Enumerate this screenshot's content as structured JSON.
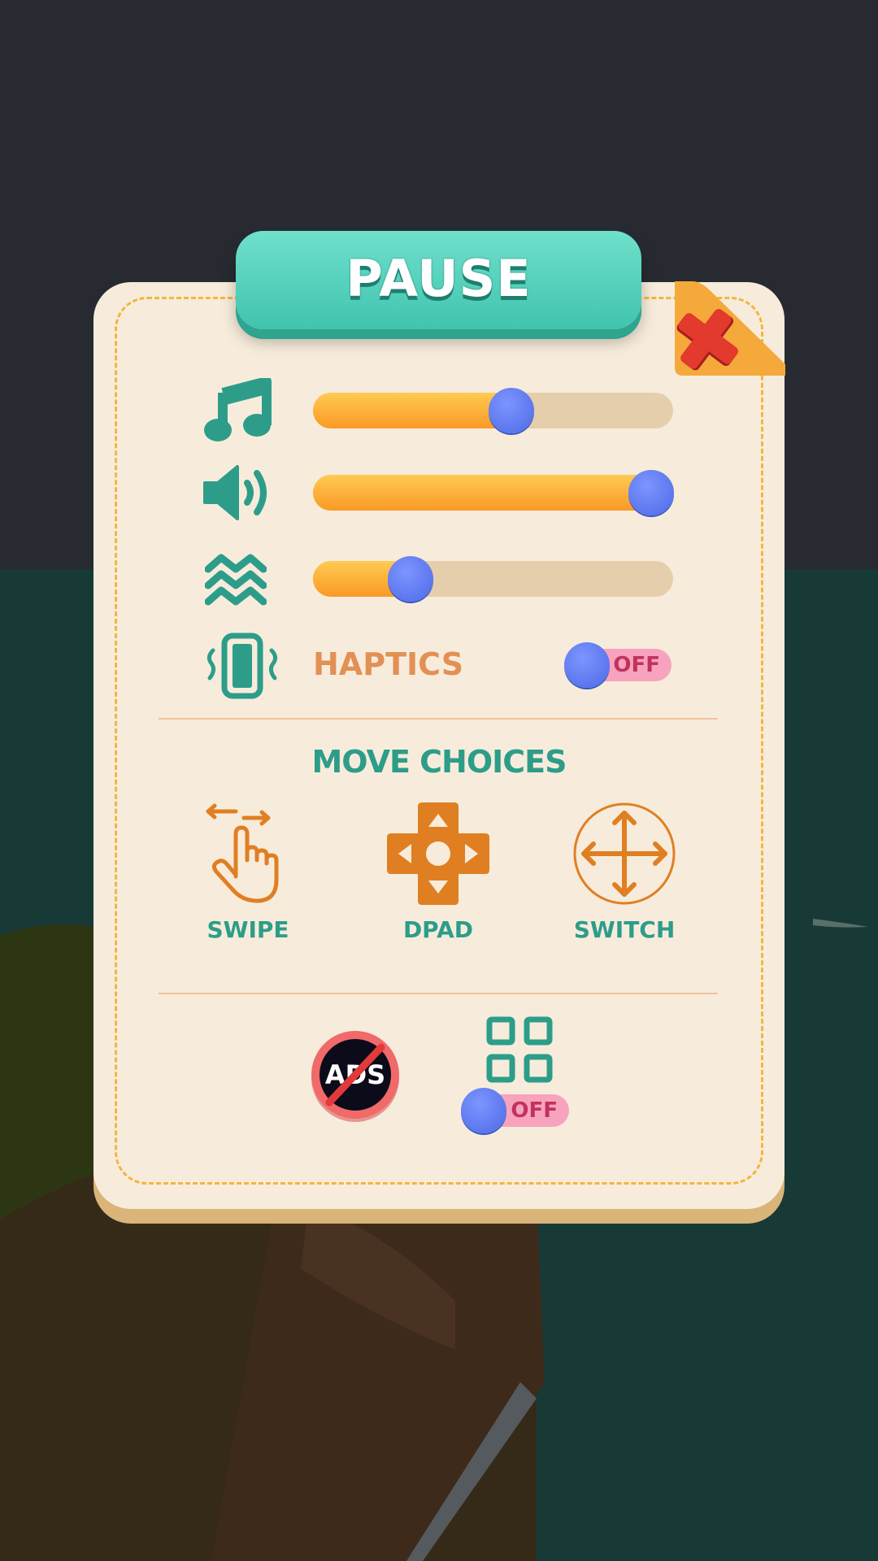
{
  "title": "PAUSE",
  "sliders": [
    {
      "name": "music",
      "icon": "music-note-icon",
      "value": 0.55
    },
    {
      "name": "sound",
      "icon": "speaker-icon",
      "value": 0.94
    },
    {
      "name": "ambience",
      "icon": "waves-icon",
      "value": 0.27
    }
  ],
  "haptics": {
    "label": "HAPTICS",
    "icon": "vibrate-phone-icon",
    "state": "OFF"
  },
  "move_choices": {
    "title": "MOVE CHOICES",
    "options": [
      {
        "label": "SWIPE",
        "icon": "swipe-hand-icon"
      },
      {
        "label": "DPAD",
        "icon": "dpad-icon"
      },
      {
        "label": "SWITCH",
        "icon": "move-arrows-icon"
      }
    ]
  },
  "extras": {
    "no_ads_label": "ADS",
    "grid_toggle_state": "OFF"
  },
  "colors": {
    "panel": "#f7ecdb",
    "teal": "#2d9d8a",
    "orange": "#e07f22",
    "knob": "#5b75f0",
    "toggle_off": "#f7a3bd"
  }
}
